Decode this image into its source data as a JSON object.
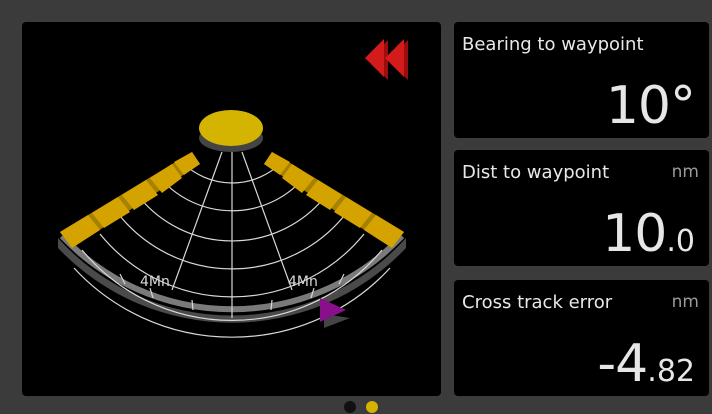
{
  "navigation": {
    "range_left_label": "4Mn",
    "range_right_label": "4Mn",
    "colors": {
      "boat": "#d4b400",
      "sector": "#d4a300",
      "rewind_arrow": "#cc1616",
      "waypoint_marker": "#8a0f8a"
    }
  },
  "tiles": [
    {
      "label": "Bearing to waypoint",
      "unit": "",
      "value_int": "10°",
      "value_dec": ""
    },
    {
      "label": "Dist to waypoint",
      "unit": "nm",
      "value_int": "10",
      "value_dec": ".0"
    },
    {
      "label": "Cross track error",
      "unit": "nm",
      "value_int": "-4",
      "value_dec": ".82"
    }
  ],
  "pager": {
    "page_count": 2,
    "active_index": 1,
    "active_color": "#d4b400",
    "inactive_color": "#111111"
  }
}
